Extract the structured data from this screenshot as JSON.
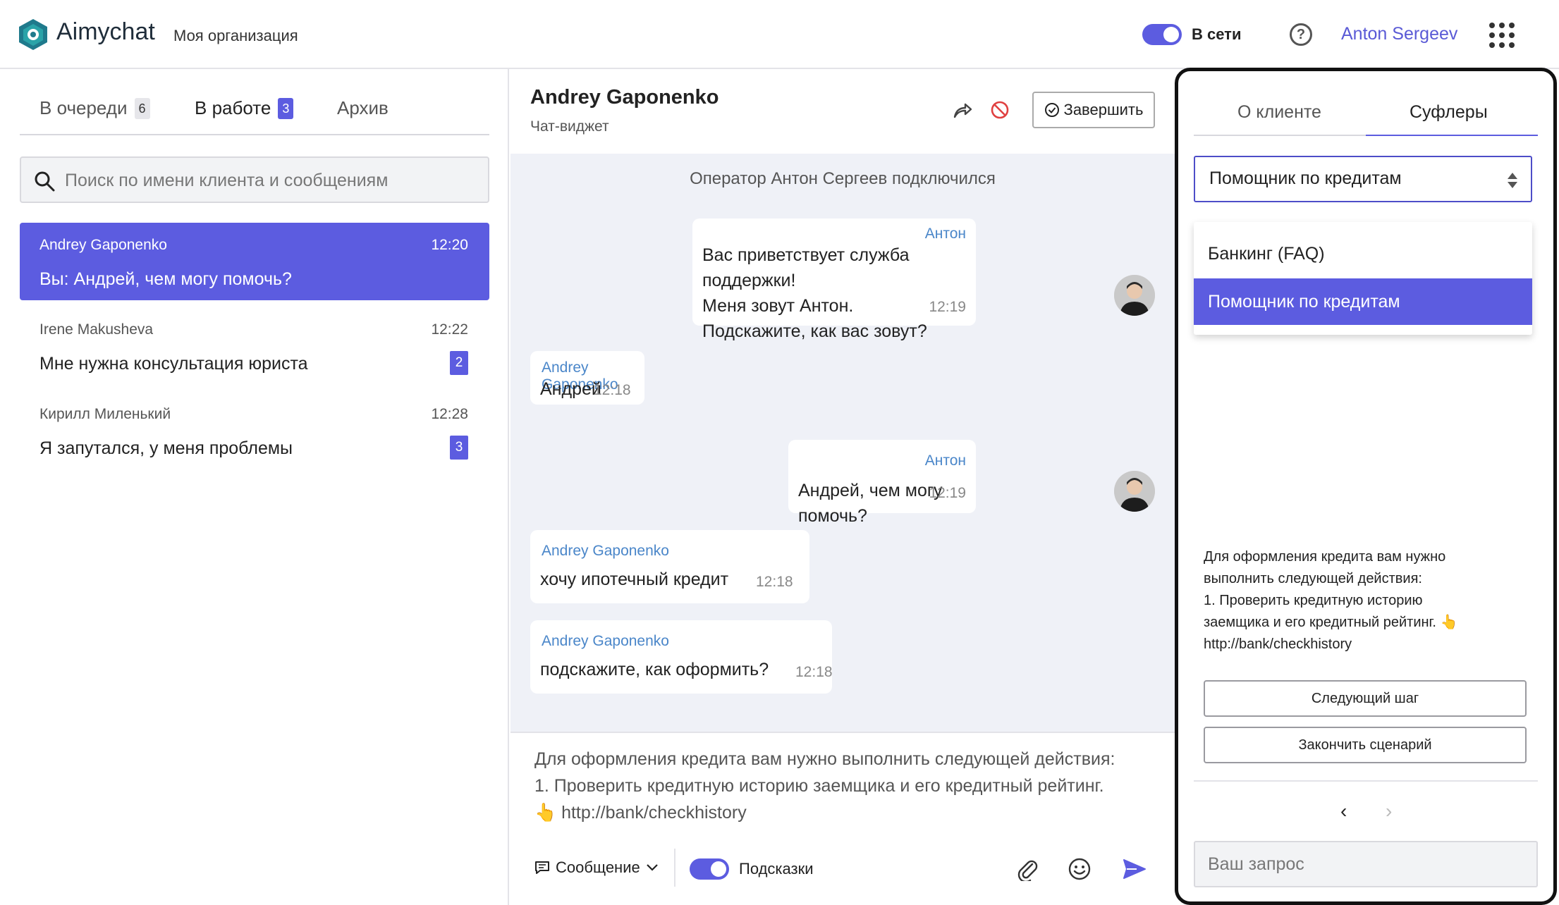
{
  "header": {
    "brand": "Aimychat",
    "organization": "Моя организация",
    "status_label": "В сети",
    "user_name": "Anton Sergeev"
  },
  "colors": {
    "accent": "#5c5ce0",
    "author": "#4a86c9",
    "chat_background": "#eff1f7"
  },
  "left": {
    "tabs": [
      {
        "label": "В очереди",
        "count": "6"
      },
      {
        "label": "В работе",
        "count": "3"
      },
      {
        "label": "Архив"
      }
    ],
    "search_placeholder": "Поиск по имени клиента и сообщениям",
    "chats": [
      {
        "name": "Andrey Gaponenko",
        "time": "12:20",
        "preview": "Вы: Андрей, чем могу помочь?"
      },
      {
        "name": "Irene Makusheva",
        "time": "12:22",
        "preview": "Мне нужна консультация юриста",
        "count": "2"
      },
      {
        "name": "Кирилл Миленький",
        "time": "12:28",
        "preview": "Я запутался, у меня проблемы",
        "count": "3"
      }
    ]
  },
  "chat": {
    "title": "Andrey Gaponenko",
    "channel": "Чат-виджет",
    "finish_label": "Завершить",
    "system_message": "Оператор Антон Сергеев подключился",
    "messages": [
      {
        "author": "Антон",
        "lines": [
          "Вас приветствует служба поддержки!",
          "Меня зовут Антон.",
          "Подскажите, как вас зовут?"
        ],
        "time": "12:19"
      },
      {
        "author": "Andrey Gaponenko",
        "text": "Андрей",
        "time": "12:18"
      },
      {
        "author": "Антон",
        "text": "Андрей, чем могу помочь?",
        "time": "12:19"
      },
      {
        "author": "Andrey Gaponenko",
        "text": "хочу ипотечный кредит",
        "time": "12:18"
      },
      {
        "author": "Andrey Gaponenko",
        "text": "подскажите, как оформить?",
        "time": "12:18"
      }
    ],
    "composer_lines": [
      "Для оформления кредита вам нужно выполнить следующей действия:",
      "1. Проверить кредитную историю заемщика и его кредитный рейтинг.",
      "👆 http://bank/checkhistory"
    ],
    "message_type": "Сообщение",
    "hints_label": "Подсказки"
  },
  "right": {
    "tabs": [
      "О клиенте",
      "Суфлеры"
    ],
    "selected": "Помощник по кредитам",
    "options": [
      "Банкинг (FAQ)",
      "Помощник по кредитам"
    ],
    "hint_lines": [
      "Для оформления кредита вам нужно",
      "выполнить следующей действия:",
      "1. Проверить кредитную историю",
      "заемщика и его кредитный рейтинг. 👆",
      "http://bank/checkhistory"
    ],
    "next_step": "Следующий шаг",
    "finish_scenario": "Закончить сценарий",
    "query_placeholder": "Ваш запрос"
  }
}
